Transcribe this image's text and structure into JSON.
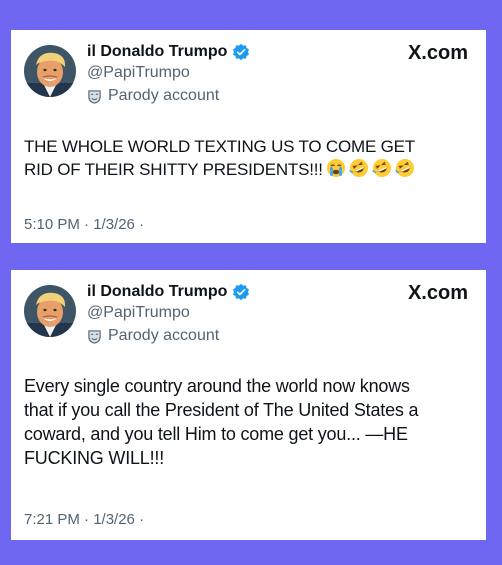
{
  "posts": [
    {
      "author": {
        "display_name": "il Donaldo Trumpo",
        "handle": "@PapiTrumpo",
        "label": "Parody account",
        "verified": true
      },
      "site": "X.com",
      "text": "THE WHOLE WORLD TEXTING US TO COME GET\nRID OF THEIR SHITTY PRESIDENTS!!!",
      "emojis": [
        "loudly-crying-face",
        "rolling-on-the-floor-laughing",
        "rolling-on-the-floor-laughing",
        "rolling-on-the-floor-laughing"
      ],
      "timestamp": "5:10 PM · 1/3/26 ·"
    },
    {
      "author": {
        "display_name": "il Donaldo Trumpo",
        "handle": "@PapiTrumpo",
        "label": "Parody account",
        "verified": true
      },
      "site": "X.com",
      "text": "Every single country around the world now knows\nthat if you call the President of The United States a\ncoward, and you tell Him to come get you... —HE\nFUCKING WILL!!!",
      "emojis": [],
      "timestamp": "7:21 PM · 1/3/26 ·"
    }
  ],
  "colors": {
    "background": "#6f67f2",
    "card": "#ffffff",
    "text_primary": "#0f1419",
    "text_secondary": "#536471",
    "verified_badge": "#1d9bf0"
  }
}
